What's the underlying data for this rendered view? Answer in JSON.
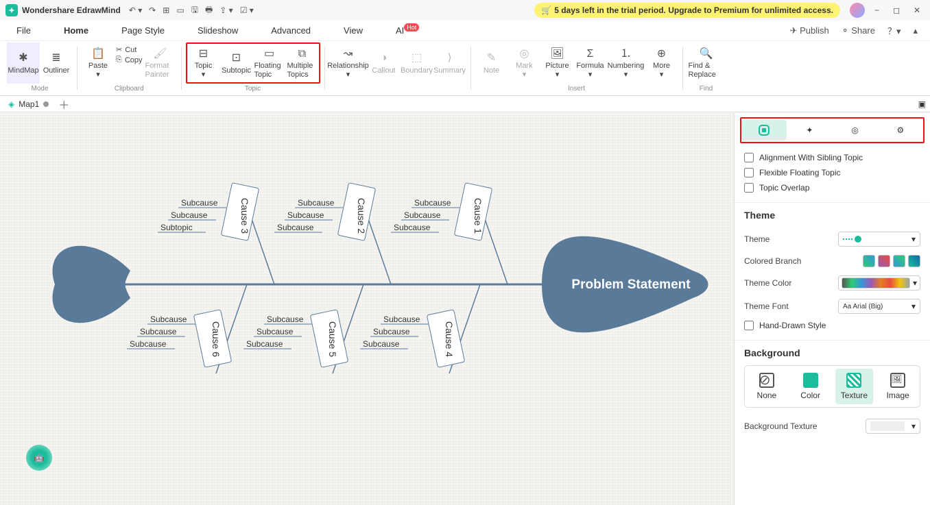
{
  "app": {
    "name": "Wondershare EdrawMind"
  },
  "trial": {
    "text": "5 days left in the trial period. Upgrade to Premium for unlimited access."
  },
  "menubar": {
    "tabs": [
      "File",
      "Home",
      "Page Style",
      "Slideshow",
      "Advanced",
      "View",
      "AI"
    ],
    "active": 1,
    "publish": "Publish",
    "share": "Share"
  },
  "ribbon": {
    "mindmap": "MindMap",
    "outliner": "Outliner",
    "paste": "Paste",
    "cut": "Cut",
    "copy": "Copy",
    "format": "Format Painter",
    "topic": "Topic",
    "subtopic": "Subtopic",
    "floating": "Floating Topic",
    "multiple": "Multiple Topics",
    "relationship": "Relationship",
    "callout": "Callout",
    "boundary": "Boundary",
    "summary": "Summary",
    "note": "Note",
    "mark": "Mark",
    "picture": "Picture",
    "formula": "Formula",
    "numbering": "Numbering",
    "more": "More",
    "find": "Find & Replace",
    "group_mode": "Mode",
    "group_clipboard": "Clipboard",
    "group_topic": "Topic",
    "group_insert": "Insert",
    "group_find": "Find"
  },
  "doc": {
    "tab1": "Map1"
  },
  "sidebar": {
    "align": "Alignment With Sibling Topic",
    "flex": "Flexible Floating Topic",
    "overlap": "Topic Overlap",
    "theme_title": "Theme",
    "theme": "Theme",
    "colored": "Colored Branch",
    "tcolor": "Theme Color",
    "tfont": "Theme Font",
    "font_value": "Arial (Big)",
    "handdrawn": "Hand-Drawn Style",
    "bg_title": "Background",
    "bg_none": "None",
    "bg_color": "Color",
    "bg_texture": "Texture",
    "bg_image": "Image",
    "bg_tex_label": "Background Texture"
  },
  "diagram": {
    "head": "Problem Statement",
    "top_causes": [
      "Cause 3",
      "Cause 2",
      "Cause 1"
    ],
    "bottom_causes": [
      "Cause 6",
      "Cause 5",
      "Cause 4"
    ],
    "top_subs": [
      [
        "Subcause",
        "Subcause",
        "Subtopic"
      ],
      [
        "Subcause",
        "Subcause",
        "Subcause"
      ],
      [
        "Subcause",
        "Subcause",
        "Subcause"
      ]
    ],
    "bottom_subs": [
      [
        "Subcause",
        "Subcause",
        "Subcause"
      ],
      [
        "Subcause",
        "Subcause",
        "Subcause"
      ],
      [
        "Subcause",
        "Subcause",
        "Subcause"
      ]
    ]
  }
}
